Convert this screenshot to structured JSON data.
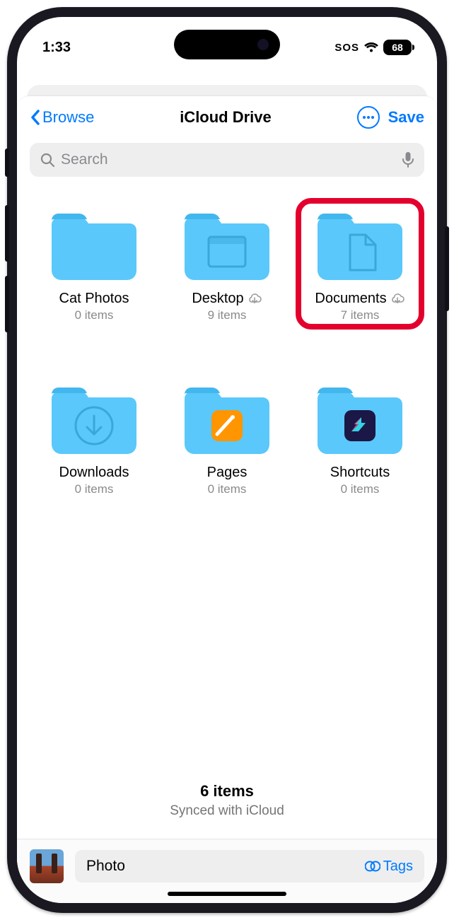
{
  "status": {
    "time": "1:33",
    "sos": "SOS",
    "battery": "68"
  },
  "nav": {
    "back": "Browse",
    "title": "iCloud Drive",
    "save": "Save"
  },
  "search": {
    "placeholder": "Search"
  },
  "folders": [
    {
      "name": "Cat Photos",
      "sub": "0 items",
      "cloud": false,
      "overlay": "none",
      "highlight": false
    },
    {
      "name": "Desktop",
      "sub": "9 items",
      "cloud": true,
      "overlay": "desktop",
      "highlight": false
    },
    {
      "name": "Documents",
      "sub": "7 items",
      "cloud": true,
      "overlay": "doc",
      "highlight": true
    },
    {
      "name": "Downloads",
      "sub": "0 items",
      "cloud": false,
      "overlay": "download",
      "highlight": false
    },
    {
      "name": "Pages",
      "sub": "0 items",
      "cloud": false,
      "overlay": "pages",
      "highlight": false
    },
    {
      "name": "Shortcuts",
      "sub": "0 items",
      "cloud": false,
      "overlay": "shortcuts",
      "highlight": false
    }
  ],
  "summary": {
    "count": "6 items",
    "sync": "Synced with iCloud"
  },
  "save_row": {
    "name": "Photo",
    "tags": "Tags"
  }
}
